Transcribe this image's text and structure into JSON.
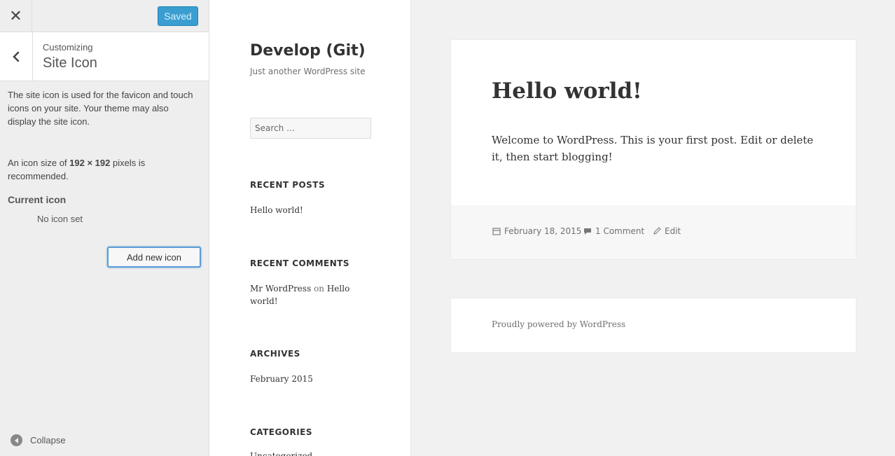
{
  "customizer": {
    "close_icon": "close-icon",
    "saved_label": "Saved",
    "customizing_label": "Customizing",
    "section_title": "Site Icon",
    "description": "The site icon is used for the favicon and touch icons on your site. Your theme may also display the site icon.",
    "size_note_prefix": "An icon size of ",
    "size_note_size": "192 × 192",
    "size_note_suffix": " pixels is recommended.",
    "current_icon_label": "Current icon",
    "no_icon_text": "No icon set",
    "add_button": "Add new icon",
    "collapse_label": "Collapse",
    "accent_color": "#3a9fd0"
  },
  "site": {
    "title": "Develop (Git)",
    "tagline": "Just another WordPress site",
    "search_placeholder": "Search …",
    "widgets": {
      "recent_posts": {
        "title": "RECENT POSTS",
        "items": [
          "Hello world!"
        ]
      },
      "recent_comments": {
        "title": "RECENT COMMENTS",
        "author": "Mr WordPress",
        "on": "on",
        "post": "Hello world!"
      },
      "archives": {
        "title": "ARCHIVES",
        "items": [
          "February 2015"
        ]
      },
      "categories": {
        "title": "CATEGORIES",
        "items": [
          "Uncategorized"
        ]
      }
    }
  },
  "post": {
    "title": "Hello world!",
    "body": "Welcome to WordPress. This is your first post. Edit or delete it, then start blogging!",
    "date": "February 18, 2015",
    "comments": "1 Comment",
    "edit": "Edit"
  },
  "footer": {
    "powered_by": "Proudly powered by WordPress"
  }
}
